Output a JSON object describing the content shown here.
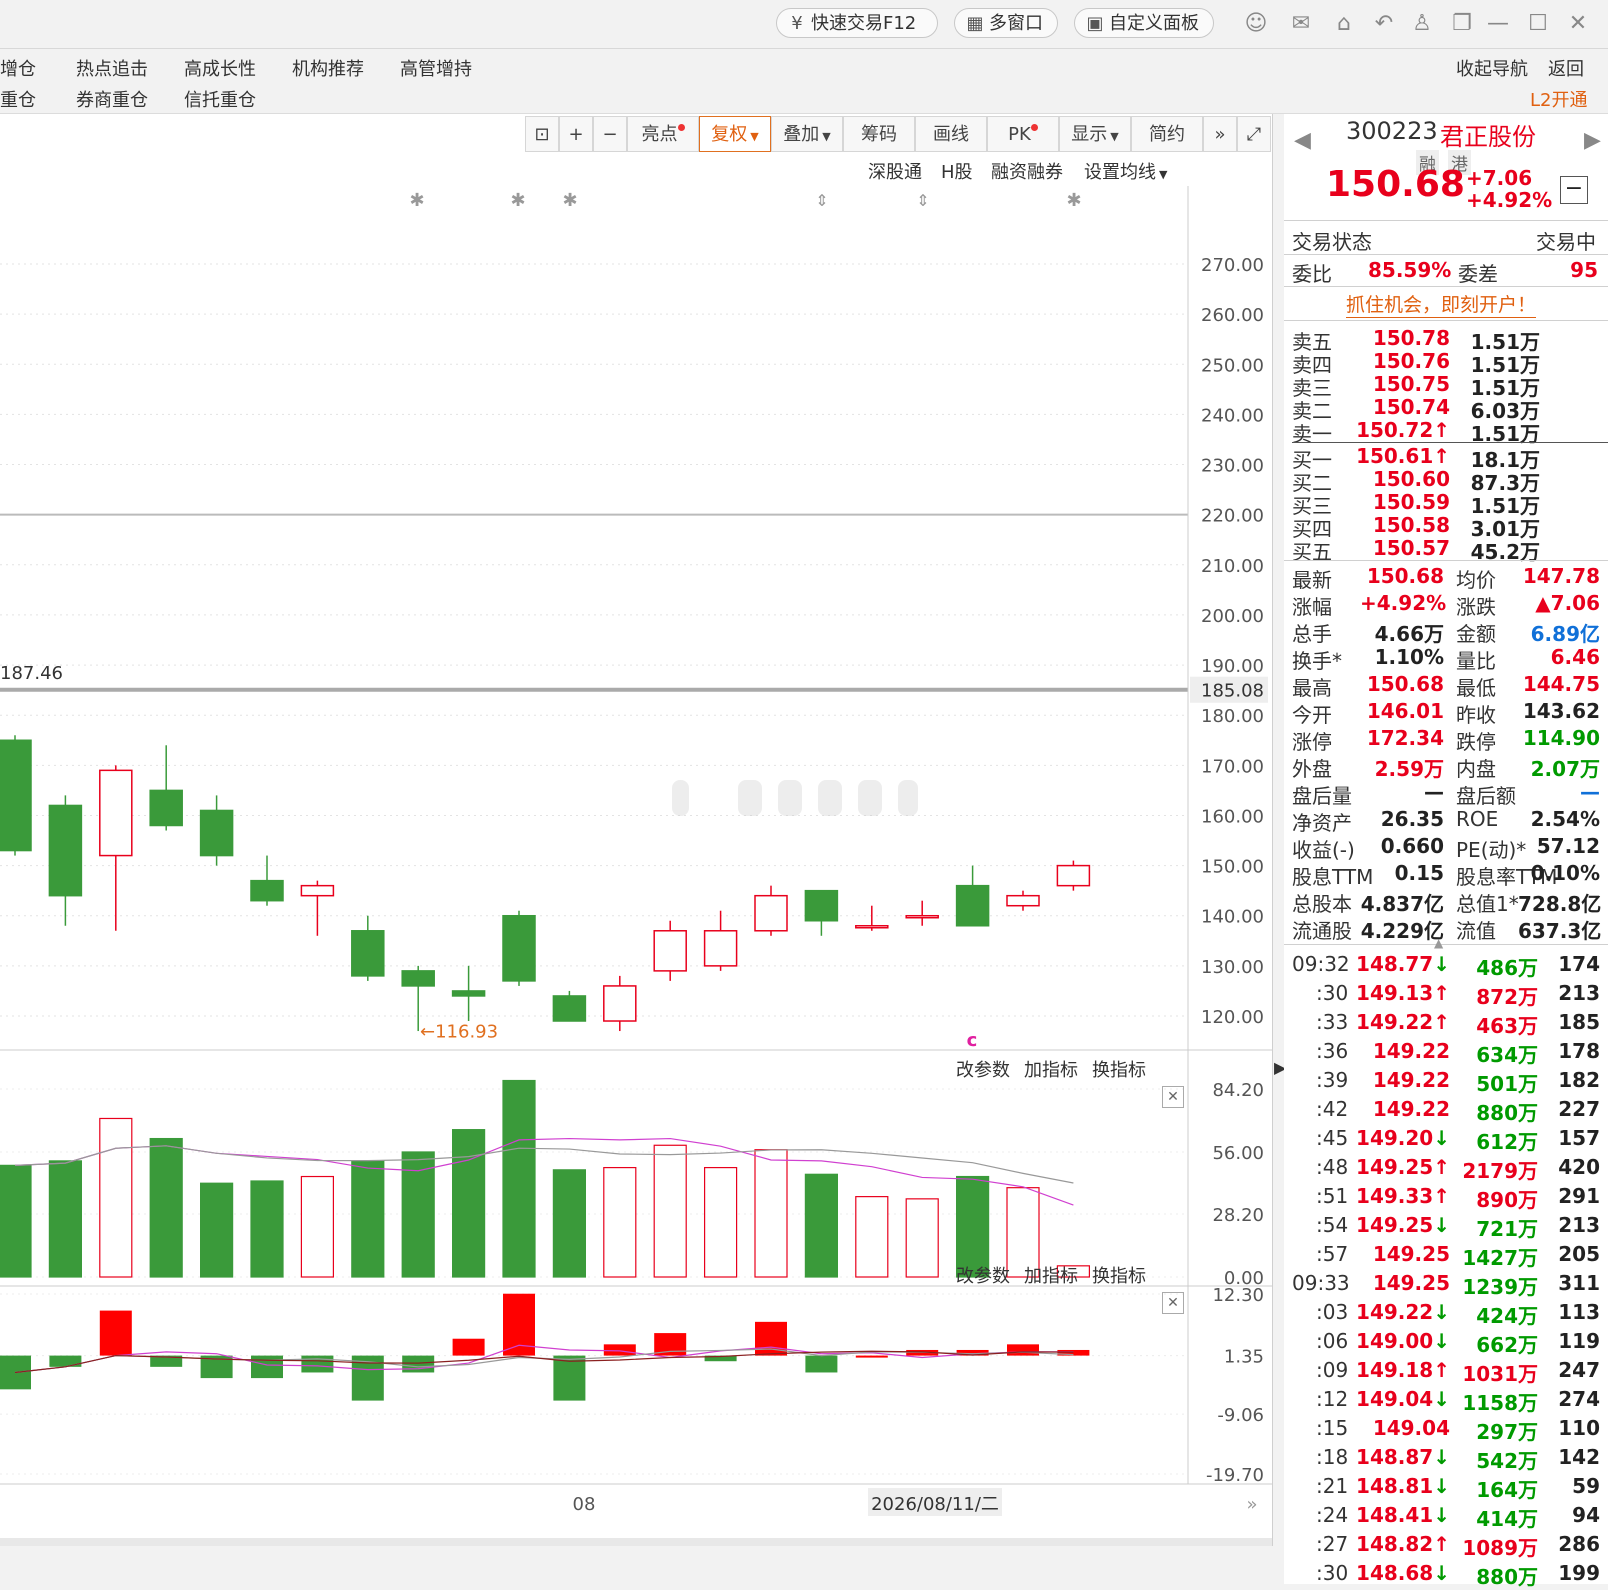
{
  "topbar": {
    "quick_trade": "快速交易F12",
    "multi_window": "多窗口",
    "custom_panel": "自定义面板"
  },
  "nav": {
    "row1": [
      "增仓",
      "热点追击",
      "高成长性",
      "机构推荐",
      "高管增持"
    ],
    "row2": [
      "重仓",
      "券商重仓",
      "信托重仓"
    ],
    "collapse": "收起导航",
    "back": "返回",
    "l2": "L2开通"
  },
  "toolbar": {
    "items": [
      "亮点",
      "复权",
      "叠加",
      "筹码",
      "画线",
      "PK",
      "显示",
      "简约"
    ],
    "links": [
      "深股通",
      "H股",
      "融资融券",
      "设置均线"
    ]
  },
  "kline": {
    "yticks": [
      "270.00",
      "260.00",
      "250.00",
      "240.00",
      "230.00",
      "220.00",
      "210.00",
      "200.00",
      "190.00",
      "180.00",
      "170.00",
      "160.00",
      "150.00",
      "140.00",
      "130.00",
      "120.00"
    ],
    "high_label": "187.46",
    "cursor_price": "185.08",
    "low_label": "←116.93",
    "c_marker": "c"
  },
  "indicator_controls": {
    "param": "改参数",
    "add": "加指标",
    "change": "换指标"
  },
  "volume": {
    "yticks": [
      "84.20",
      "56.00",
      "28.20",
      "0.00"
    ]
  },
  "macd": {
    "yticks": [
      "12.30",
      "1.35",
      "-9.06",
      "-19.70"
    ]
  },
  "xaxis": {
    "month_label": "08",
    "cursor_date": "2026/08/11/二"
  },
  "quote": {
    "code": "300223",
    "name": "君正股份",
    "tags": [
      "融",
      "港"
    ],
    "price": "150.68",
    "change": "+7.06",
    "change_pct": "+4.92%",
    "status_label": "交易状态",
    "status_value": "交易中",
    "weibi_label": "委比",
    "weibi": "85.59%",
    "weicha_label": "委差",
    "weicha": "95",
    "promo": "抓住机会，即刻开户！"
  },
  "order_book": {
    "asks": [
      {
        "label": "卖五",
        "price": "150.78",
        "vol": "1.51万"
      },
      {
        "label": "卖四",
        "price": "150.76",
        "vol": "1.51万"
      },
      {
        "label": "卖三",
        "price": "150.75",
        "vol": "1.51万"
      },
      {
        "label": "卖二",
        "price": "150.74",
        "vol": "6.03万"
      },
      {
        "label": "卖一",
        "price": "150.72↑",
        "vol": "1.51万"
      }
    ],
    "bids": [
      {
        "label": "买一",
        "price": "150.61↑",
        "vol": "18.1万"
      },
      {
        "label": "买二",
        "price": "150.60",
        "vol": "87.3万"
      },
      {
        "label": "买三",
        "price": "150.59",
        "vol": "1.51万"
      },
      {
        "label": "买四",
        "price": "150.58",
        "vol": "3.01万"
      },
      {
        "label": "买五",
        "price": "150.57",
        "vol": "45.2万"
      }
    ]
  },
  "stats": [
    {
      "l1": "最新",
      "v1": "150.68",
      "c1": "red",
      "l2": "均价",
      "v2": "147.78",
      "c2": "red"
    },
    {
      "l1": "涨幅",
      "v1": "+4.92%",
      "c1": "red",
      "l2": "涨跌",
      "v2": "▲7.06",
      "c2": "red"
    },
    {
      "l1": "总手",
      "v1": "4.66万",
      "c1": "dark",
      "l2": "金额",
      "v2": "6.89亿",
      "c2": "blue"
    },
    {
      "l1": "换手*",
      "v1": "1.10%",
      "c1": "dark",
      "l2": "量比",
      "v2": "6.46",
      "c2": "red"
    },
    {
      "l1": "最高",
      "v1": "150.68",
      "c1": "red",
      "l2": "最低",
      "v2": "144.75",
      "c2": "red"
    },
    {
      "l1": "今开",
      "v1": "146.01",
      "c1": "red",
      "l2": "昨收",
      "v2": "143.62",
      "c2": "dark"
    },
    {
      "l1": "涨停",
      "v1": "172.34",
      "c1": "red",
      "l2": "跌停",
      "v2": "114.90",
      "c2": "green"
    },
    {
      "l1": "外盘",
      "v1": "2.59万",
      "c1": "red",
      "l2": "内盘",
      "v2": "2.07万",
      "c2": "green"
    },
    {
      "l1": "盘后量",
      "v1": "—",
      "c1": "dark",
      "l2": "盘后额",
      "v2": "—",
      "c2": "blue"
    },
    {
      "l1": "净资产",
      "v1": "26.35",
      "c1": "dark",
      "l2": "ROE",
      "v2": "2.54%",
      "c2": "dark"
    },
    {
      "l1": "收益(-)",
      "v1": "0.660",
      "c1": "dark",
      "l2": "PE(动)*",
      "v2": "57.12",
      "c2": "dark"
    },
    {
      "l1": "股息TTM",
      "v1": "0.15",
      "c1": "dark",
      "l2": "股息率TTM",
      "v2": "0.10%",
      "c2": "dark"
    },
    {
      "l1": "总股本",
      "v1": "4.837亿",
      "c1": "dark",
      "l2": "总值1*",
      "v2": "728.8亿",
      "c2": "dark"
    },
    {
      "l1": "流通股",
      "v1": "4.229亿",
      "c1": "dark",
      "l2": "流值",
      "v2": "637.3亿",
      "c2": "dark"
    }
  ],
  "ticks": [
    {
      "t": "09:32",
      "p": "148.77",
      "d": "↓",
      "a": "486万",
      "n": "174"
    },
    {
      "t": ":30",
      "p": "149.13",
      "d": "↑",
      "a": "872万",
      "n": "213"
    },
    {
      "t": ":33",
      "p": "149.22",
      "d": "↑",
      "a": "463万",
      "n": "185"
    },
    {
      "t": ":36",
      "p": "149.22",
      "d": "",
      "a": "634万",
      "n": "178"
    },
    {
      "t": ":39",
      "p": "149.22",
      "d": "",
      "a": "501万",
      "n": "182"
    },
    {
      "t": ":42",
      "p": "149.22",
      "d": "",
      "a": "880万",
      "n": "227"
    },
    {
      "t": ":45",
      "p": "149.20",
      "d": "↓",
      "a": "612万",
      "n": "157"
    },
    {
      "t": ":48",
      "p": "149.25",
      "d": "↑",
      "a": "2179万",
      "n": "420"
    },
    {
      "t": ":51",
      "p": "149.33",
      "d": "↑",
      "a": "890万",
      "n": "291"
    },
    {
      "t": ":54",
      "p": "149.25",
      "d": "↓",
      "a": "721万",
      "n": "213"
    },
    {
      "t": ":57",
      "p": "149.25",
      "d": "",
      "a": "1427万",
      "n": "205"
    },
    {
      "t": "09:33",
      "p": "149.25",
      "d": "",
      "a": "1239万",
      "n": "311"
    },
    {
      "t": ":03",
      "p": "149.22",
      "d": "↓",
      "a": "424万",
      "n": "113"
    },
    {
      "t": ":06",
      "p": "149.00",
      "d": "↓",
      "a": "662万",
      "n": "119"
    },
    {
      "t": ":09",
      "p": "149.18",
      "d": "↑",
      "a": "1031万",
      "n": "247"
    },
    {
      "t": ":12",
      "p": "149.04",
      "d": "↓",
      "a": "1158万",
      "n": "274"
    },
    {
      "t": ":15",
      "p": "149.04",
      "d": "",
      "a": "297万",
      "n": "110"
    },
    {
      "t": ":18",
      "p": "148.87",
      "d": "↓",
      "a": "542万",
      "n": "142"
    },
    {
      "t": ":21",
      "p": "148.81",
      "d": "↓",
      "a": "164万",
      "n": "59"
    },
    {
      "t": ":24",
      "p": "148.41",
      "d": "↓",
      "a": "414万",
      "n": "94"
    },
    {
      "t": ":27",
      "p": "148.82",
      "d": "↑",
      "a": "1089万",
      "n": "286"
    },
    {
      "t": ":30",
      "p": "148.68",
      "d": "↓",
      "a": "880万",
      "n": "199"
    }
  ],
  "colors": {
    "up": "#e8001c",
    "down": "#3a9a3a",
    "accent": "#e06010"
  },
  "chart_data": {
    "type": "candlestick",
    "ylim": [
      115,
      275
    ],
    "candles": [
      {
        "open": 175,
        "close": 153,
        "high": 176,
        "low": 152
      },
      {
        "open": 162,
        "close": 144,
        "high": 164,
        "low": 138
      },
      {
        "open": 152,
        "close": 169,
        "high": 170,
        "low": 137
      },
      {
        "open": 165,
        "close": 158,
        "high": 174,
        "low": 157
      },
      {
        "open": 161,
        "close": 152,
        "high": 164,
        "low": 150
      },
      {
        "open": 147,
        "close": 143,
        "high": 152,
        "low": 142
      },
      {
        "open": 144,
        "close": 146,
        "high": 147,
        "low": 136
      },
      {
        "open": 137,
        "close": 128,
        "high": 140,
        "low": 127
      },
      {
        "open": 129,
        "close": 126,
        "high": 130,
        "low": 117
      },
      {
        "open": 125,
        "close": 124,
        "high": 130,
        "low": 119
      },
      {
        "open": 140,
        "close": 127,
        "high": 141,
        "low": 126
      },
      {
        "open": 124,
        "close": 119,
        "high": 125,
        "low": 119
      },
      {
        "open": 119,
        "close": 126,
        "high": 128,
        "low": 117
      },
      {
        "open": 129,
        "close": 137,
        "high": 139,
        "low": 127
      },
      {
        "open": 130,
        "close": 137,
        "high": 141,
        "low": 129
      },
      {
        "open": 137,
        "close": 144,
        "high": 146,
        "low": 136
      },
      {
        "open": 145,
        "close": 139,
        "high": 145,
        "low": 136
      },
      {
        "open": 138,
        "close": 138,
        "high": 142,
        "low": 137
      },
      {
        "open": 140,
        "close": 140,
        "high": 143,
        "low": 138
      },
      {
        "open": 146,
        "close": 138,
        "high": 150,
        "low": 138
      },
      {
        "open": 142,
        "close": 144,
        "high": 145,
        "low": 141
      },
      {
        "open": 146,
        "close": 150,
        "high": 151,
        "low": 145
      }
    ],
    "volume": {
      "ylim": [
        0,
        84.2
      ],
      "values": [
        50,
        52,
        71,
        62,
        42,
        43,
        45,
        52,
        56,
        66,
        88,
        48,
        49,
        59,
        49,
        57,
        46,
        36,
        35,
        45,
        40,
        5
      ]
    },
    "macd": {
      "ylim": [
        -19.7,
        12.3
      ],
      "values": [
        -6,
        -2,
        8,
        -2,
        -4,
        -4,
        -3,
        -8,
        -3,
        3,
        11,
        -8,
        2,
        4,
        -1,
        6,
        -3,
        0,
        1,
        1,
        2,
        1
      ]
    }
  }
}
